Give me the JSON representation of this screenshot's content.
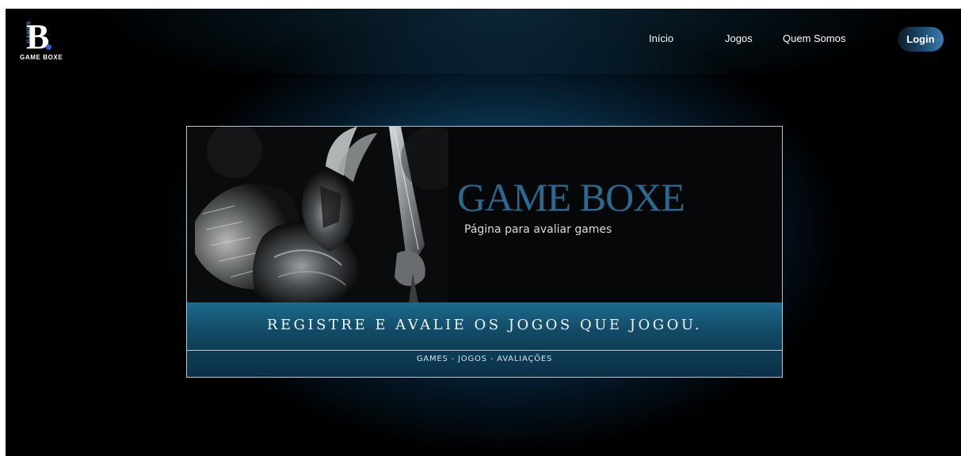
{
  "brand": {
    "logo_letter": "B",
    "logo_vertical": "GAMES",
    "logo_name": "GAME BOXE"
  },
  "nav": {
    "items": [
      {
        "label": "Início"
      },
      {
        "label": "Jogos"
      },
      {
        "label": "Quem Somos"
      }
    ],
    "login_label": "Login"
  },
  "banner": {
    "title": "GAME BOXE",
    "subtitle": "Página para avaliar games",
    "slogan": "REGISTRE E AVALIE OS JOGOS QUE JOGOU.",
    "tagline": "GAMES - JOGOS - AVALIAÇÕES",
    "art_icon": "armored-knight-illustration"
  },
  "colors": {
    "accent": "#2c6990",
    "background": "#000000",
    "strip": "#1d6a8c",
    "login_gradient_end": "#3a7fb0",
    "logo_dot": "#3b5bd0"
  }
}
